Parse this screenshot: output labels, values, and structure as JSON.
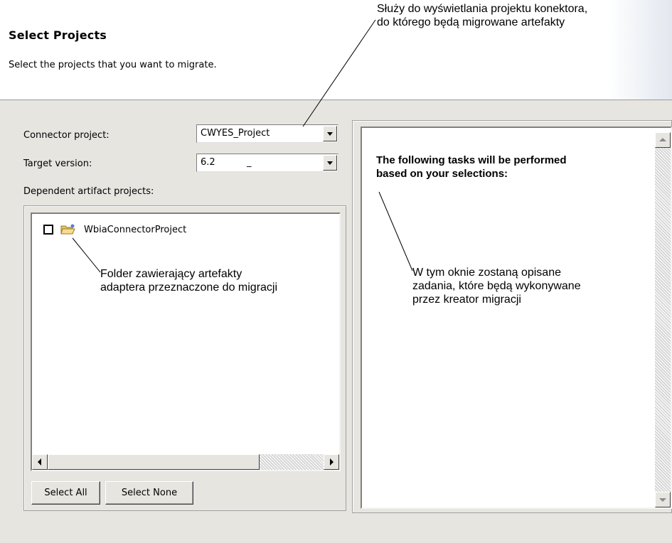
{
  "header": {
    "title": "Select Projects",
    "description": "Select the projects that you want to migrate."
  },
  "form": {
    "connector_label": "Connector project:",
    "connector_value": "CWYES_Project",
    "target_label": "Target version:",
    "target_value": "6.2",
    "target_value_cursor": "_",
    "dependent_label": "Dependent artifact projects:"
  },
  "tree": {
    "items": [
      {
        "label": "WbiaConnectorProject",
        "checked": false,
        "icon": "folder-open-icon"
      }
    ]
  },
  "buttons": {
    "select_all": "Select All",
    "select_none": "Select None"
  },
  "tasks": {
    "heading_line1": "The following tasks will be performed",
    "heading_line2": "based on your selections:"
  },
  "callouts": {
    "connector_line1": "Służy do wyświetlania projektu konektora,",
    "connector_line2": "do którego będą migrowane artefakty",
    "folder_line1": "Folder zawierający artefakty",
    "folder_line2": "adaptera przeznaczone do migracji",
    "tasks_line1": "W tym oknie zostaną opisane",
    "tasks_line2": "zadania, które będą wykonywane",
    "tasks_line3": "przez kreator migracji"
  },
  "colors": {
    "panel_bg": "#e7e5e0",
    "header_bg": "#ffffff"
  }
}
